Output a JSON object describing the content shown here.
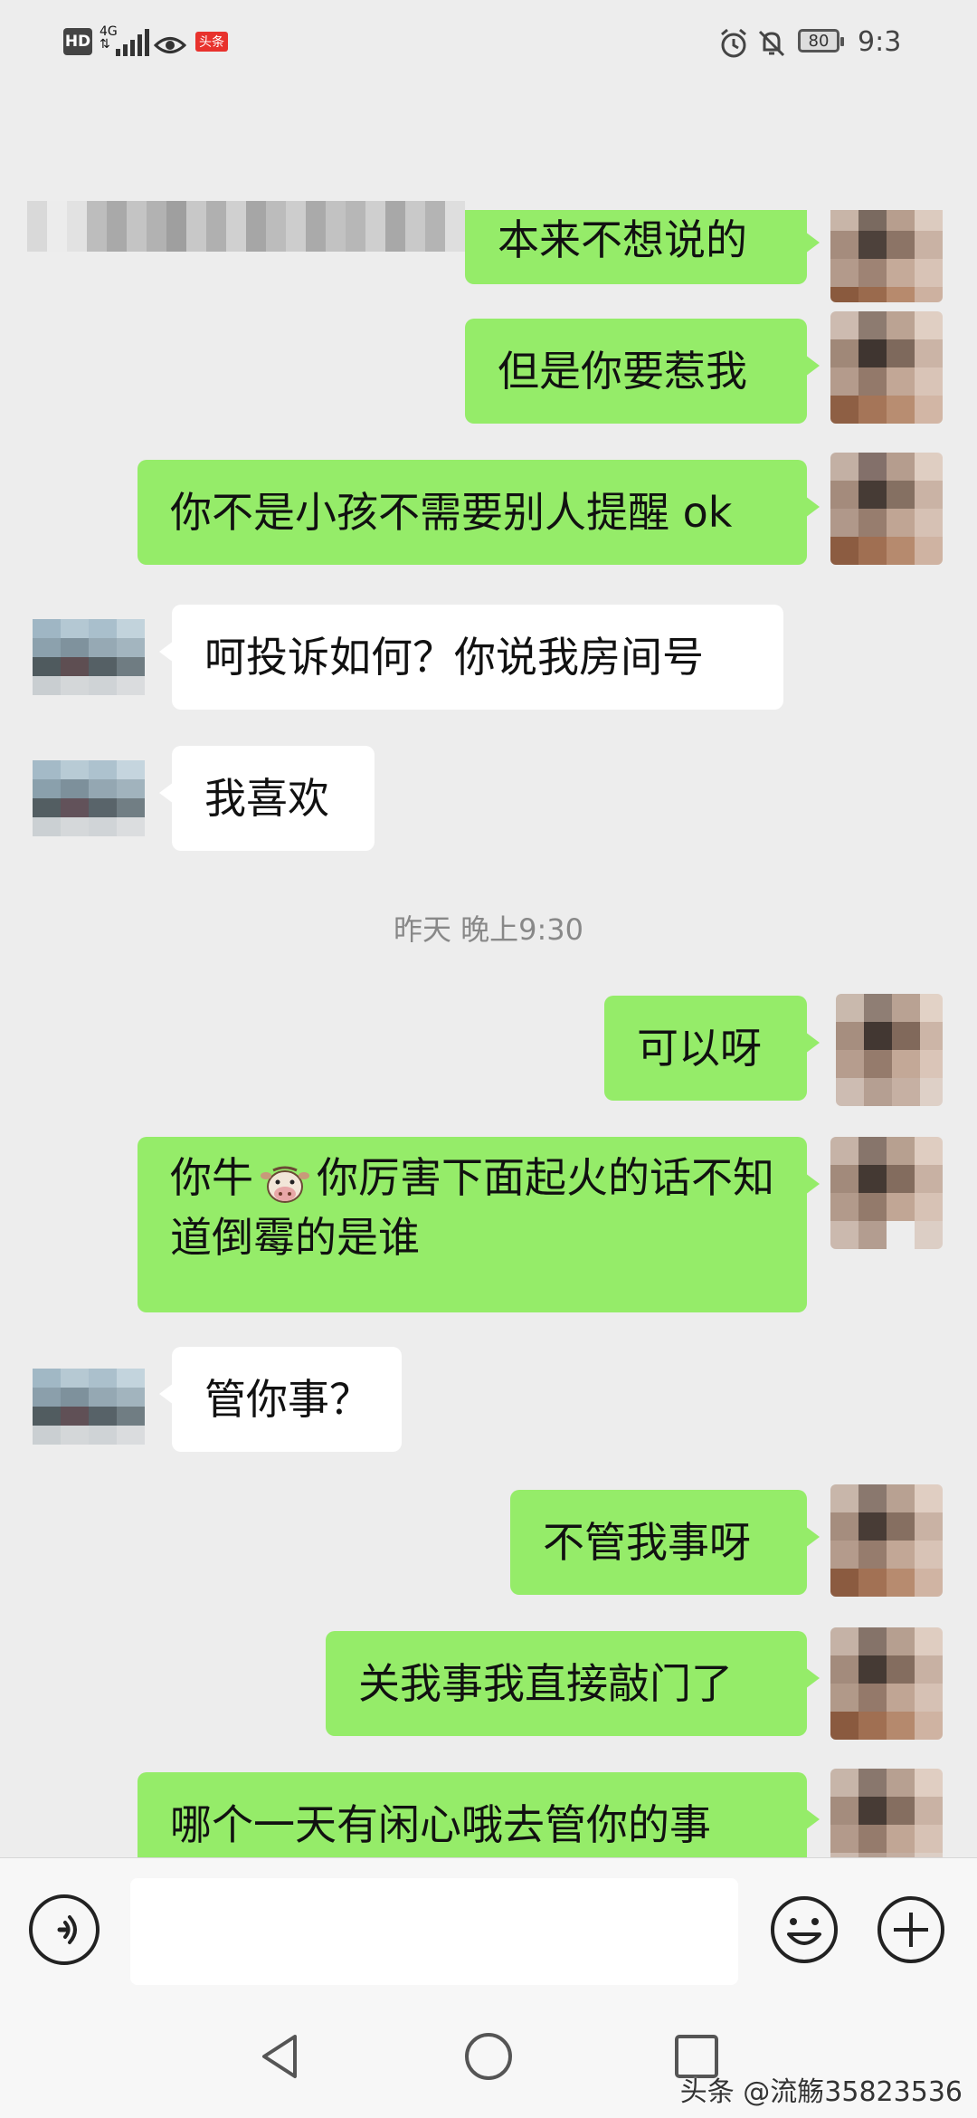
{
  "status_bar": {
    "hd": "HD",
    "network_top": "4G",
    "network_bottom": "⇅",
    "app_badge": "头条",
    "battery": "80",
    "time": "9:3"
  },
  "messages": {
    "m1": "本来不想说的",
    "m2": "但是你要惹我",
    "m3": "你不是小孩不需要别人提醒 ok",
    "m4": "呵投诉如何？你说我房间号",
    "m5": "我喜欢",
    "timestamp": "昨天 晚上9:30",
    "m6": "可以呀",
    "m7_a": "你牛",
    "m7_b": "你厉害下面起火的话不知道倒霉的是谁",
    "m8": "管你事？",
    "m9": "不管我事呀",
    "m10": "关我事我直接敲门了",
    "m11": "哪个一天有闲心哦去管你的事"
  },
  "input": {
    "placeholder": ""
  },
  "watermark": "头条 @流觞35823536",
  "colors": {
    "outgoing": "#95ec69",
    "incoming": "#ffffff",
    "background": "#ededed"
  },
  "icons": [
    "voice-icon",
    "emoji-icon",
    "plus-icon",
    "back-icon",
    "home-icon",
    "recents-icon"
  ]
}
